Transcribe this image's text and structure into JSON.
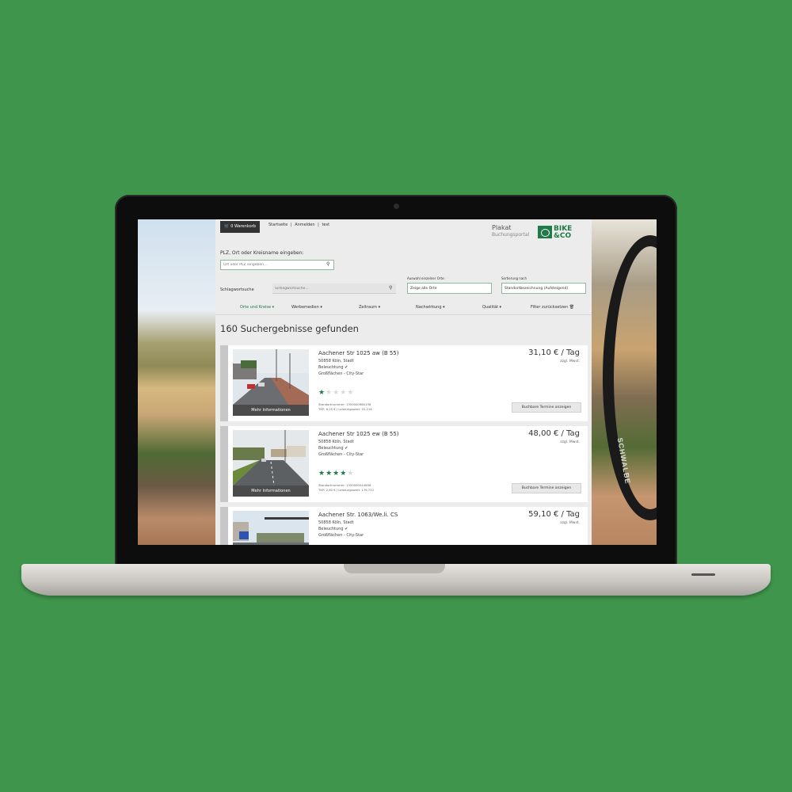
{
  "colors": {
    "background": "#3e954b",
    "accent": "#1e7a46",
    "star_off": "#d9d9d9"
  },
  "header": {
    "cart_icon": "cart-icon",
    "cart_label": "0 Warenkorb",
    "nav": [
      "Startseite",
      "|",
      "Anmelden",
      "|",
      "test"
    ],
    "brand_title": "Plakat",
    "brand_subtitle": "Buchungsportal",
    "logo_line1": "BIKE",
    "logo_line2": "&CO"
  },
  "search": {
    "plz_label": "PLZ, Ort oder Kreisname eingeben:",
    "plz_placeholder": "Ort oder PLZ eingeben...",
    "keyword_label": "Schlagwortsuche",
    "keyword_placeholder": "Schlagwortsuche...",
    "orte_label": "Auswahl einzelner Orte:",
    "orte_value": "Zeige alle Orte",
    "sort_label": "Sortierung nach",
    "sort_value": "Standortbezeichnung (Aufsteigend)"
  },
  "filters": [
    {
      "label": "Orte und Kreise ▾",
      "active": true
    },
    {
      "label": "Werbemedien ▾",
      "active": false
    },
    {
      "label": "Zeitraum ▾",
      "active": false
    },
    {
      "label": "Nachwirkung ▾",
      "active": false
    },
    {
      "label": "Qualität ▾",
      "active": false
    },
    {
      "label": "Filter zurücksetzen 🗑",
      "active": false
    }
  ],
  "results_title": "160 Suchergebnisse gefunden",
  "results": [
    {
      "title": "Aachener Str 1025 aw (B 55)",
      "address": "50858 Köln, Stadt",
      "lighting": "Beleuchtung ✔",
      "type": "Großflächen - City-Star",
      "rating": 1,
      "standort": "Standortnummer: 1350000980156",
      "stats": "TKP: 6,25 € / Leistungswert: 52.216",
      "price": "31,10 € / Tag",
      "vat": "zzgl. Mwst.",
      "info_button": "Mehr Informationen",
      "book_button": "Buchbare Termine anzeigen"
    },
    {
      "title": "Aachener Str 1025 ew (B 55)",
      "address": "50858 Köln, Stadt",
      "lighting": "Beleuchtung ✔",
      "type": "Großflächen - City-Star",
      "rating": 4,
      "standort": "Standortnummer: 1350000044858",
      "stats": "TKP: 2,80 € / Leistungswert: 176.712",
      "price": "48,00 € / Tag",
      "vat": "zzgl. Mwst.",
      "info_button": "Mehr Informationen",
      "book_button": "Buchbare Termine anzeigen"
    },
    {
      "title": "Aachener Str. 1063/We.li. CS",
      "address": "50858 Köln, Stadt",
      "lighting": "Beleuchtung ✔",
      "type": "Großflächen - City-Star",
      "price": "59,10 € / Tag",
      "vat": "zzgl. Mwst."
    }
  ],
  "photo_text": "SCHWALBE"
}
